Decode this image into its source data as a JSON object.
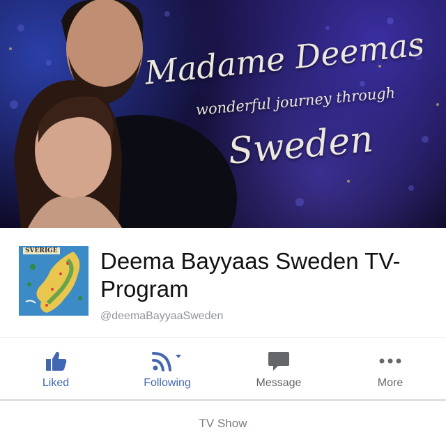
{
  "cover": {
    "title_line1": "Madame Deemas",
    "title_line2": "wonderful journey through",
    "title_line3": "Sweden"
  },
  "profile": {
    "map_label": "SVERIGE",
    "name": "Deema Bayyaas Sweden TV-Program",
    "handle": "@deemaBayyaaSweden"
  },
  "actions": [
    {
      "label": "Liked",
      "icon": "thumbs-up-icon",
      "color": "#4267b2"
    },
    {
      "label": "Following",
      "icon": "rss-feed-icon",
      "color": "#4267b2"
    },
    {
      "label": "Message",
      "icon": "speech-bubble-icon",
      "color": "#65676b"
    },
    {
      "label": "More",
      "icon": "ellipsis-icon",
      "color": "#65676b"
    }
  ],
  "category": "TV Show",
  "colors": {
    "accent": "#4267b2",
    "muted": "#90949c"
  }
}
